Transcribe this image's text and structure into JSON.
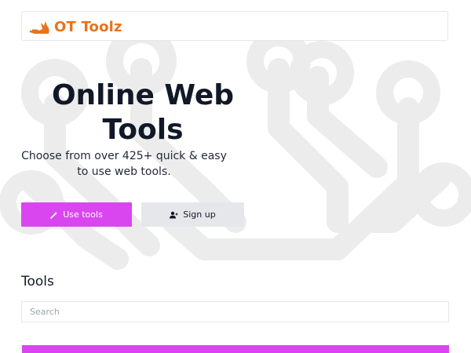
{
  "brand": {
    "name": "OT Toolz",
    "logo_icon": "fox-logo-icon",
    "accent_color": "#e8731a"
  },
  "hero": {
    "title": "Online Web Tools",
    "subtitle": "Choose from over 425+ quick & easy to use web tools."
  },
  "buttons": {
    "use_tools": {
      "label": "Use tools",
      "icon": "magic-wand-icon",
      "color": "#d946ef"
    },
    "sign_up": {
      "label": "Sign up",
      "icon": "user-plus-icon",
      "color": "#e5e7eb"
    }
  },
  "tools": {
    "heading": "Tools",
    "search_placeholder": "Search",
    "search_value": ""
  }
}
